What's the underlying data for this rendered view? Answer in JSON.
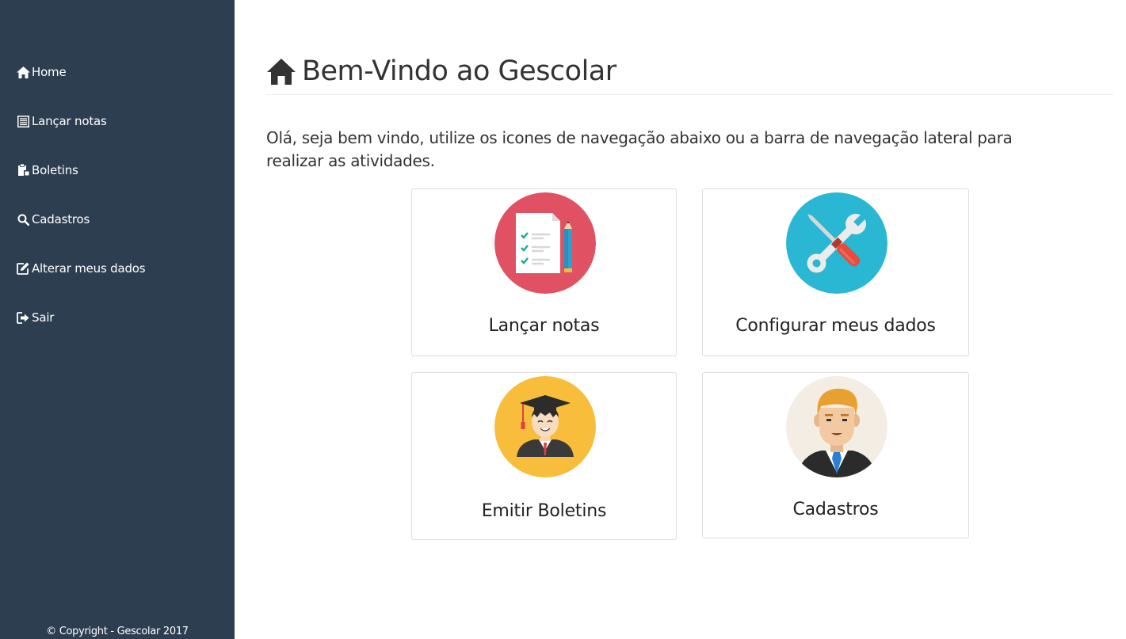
{
  "sidebar": {
    "items": [
      {
        "label": "Home",
        "icon": "home-icon"
      },
      {
        "label": "Lançar notas",
        "icon": "list-icon"
      },
      {
        "label": "Boletins",
        "icon": "clipboard-icon"
      },
      {
        "label": "Cadastros",
        "icon": "search-icon"
      },
      {
        "label": "Alterar meus dados",
        "icon": "edit-icon"
      },
      {
        "label": "Sair",
        "icon": "logout-icon"
      }
    ],
    "copyright": "© Copyright - Gescolar 2017"
  },
  "main": {
    "title": "Bem-Vindo ao Gescolar",
    "intro": "Olá, seja bem vindo, utilize os icones de navegação abaixo ou a barra de navegação lateral para realizar as atividades.",
    "cards": [
      {
        "label": "Lançar notas",
        "icon": "grades-document-icon",
        "color": "#e05263"
      },
      {
        "label": "Configurar meus dados",
        "icon": "tools-icon",
        "color": "#29b7d3"
      },
      {
        "label": "Emitir Boletins",
        "icon": "graduate-icon",
        "color": "#f8bd3a"
      },
      {
        "label": "Cadastros",
        "icon": "businessman-icon",
        "color": "#f3ede3"
      }
    ]
  },
  "colors": {
    "sidebar_bg": "#2c3e50",
    "text": "#333333"
  }
}
